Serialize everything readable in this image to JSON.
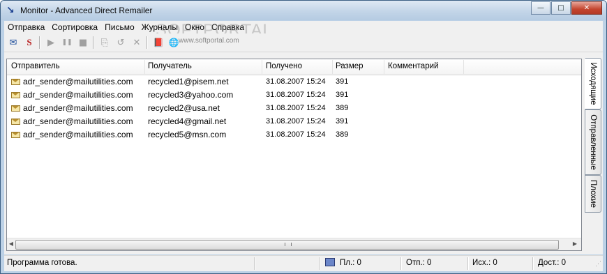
{
  "window": {
    "title": "Monitor - Advanced Direct Remailer",
    "controls": {
      "minimize": "—",
      "maximize": "□",
      "close": "✕"
    }
  },
  "menu": [
    "Отправка",
    "Сортировка",
    "Письмо",
    "Журналы",
    "Окно",
    "Справка"
  ],
  "watermark": {
    "logo": "SOFTPORTAL",
    "url": "www.softportal.com"
  },
  "toolbar": [
    {
      "icon": "new-message-icon",
      "glyph": "✉",
      "enabled": true
    },
    {
      "icon": "smtp-icon",
      "glyph": "S",
      "enabled": true
    },
    {
      "icon": "play-icon",
      "glyph": "▶",
      "enabled": false
    },
    {
      "icon": "pause-icon",
      "glyph": "❚❚",
      "enabled": false
    },
    {
      "icon": "stop-icon",
      "glyph": "■",
      "enabled": false
    },
    {
      "icon": "copy-icon",
      "glyph": "⎘",
      "enabled": false
    },
    {
      "icon": "resend-icon",
      "glyph": "↺",
      "enabled": false
    },
    {
      "icon": "delete-icon",
      "glyph": "✕",
      "enabled": false
    },
    {
      "icon": "address-book-icon",
      "glyph": "📕",
      "enabled": true
    },
    {
      "icon": "internet-globe-icon",
      "glyph": "🌐",
      "enabled": true
    }
  ],
  "table": {
    "columns": [
      "Отправитель",
      "Получатель",
      "Получено",
      "Размер",
      "Комментарий"
    ],
    "rows": [
      {
        "sender": "adr_sender@mailutilities.com",
        "recipient": "recycled1@pisem.net",
        "received": "31.08.2007 15:24",
        "size": "391",
        "comment": ""
      },
      {
        "sender": "adr_sender@mailutilities.com",
        "recipient": "recycled3@yahoo.com",
        "received": "31.08.2007 15:24",
        "size": "391",
        "comment": ""
      },
      {
        "sender": "adr_sender@mailutilities.com",
        "recipient": "recycled2@usa.net",
        "received": "31.08.2007 15:24",
        "size": "389",
        "comment": ""
      },
      {
        "sender": "adr_sender@mailutilities.com",
        "recipient": "recycled4@gmail.net",
        "received": "31.08.2007 15:24",
        "size": "391",
        "comment": ""
      },
      {
        "sender": "adr_sender@mailutilities.com",
        "recipient": "recycled5@msn.com",
        "received": "31.08.2007 15:24",
        "size": "389",
        "comment": ""
      }
    ]
  },
  "tabs": [
    {
      "label": "Исходящие",
      "active": true
    },
    {
      "label": "Отправленные",
      "active": false
    },
    {
      "label": "Плохие",
      "active": false
    }
  ],
  "status": {
    "message": "Программа готова.",
    "planned": "Пл.: 0",
    "sent": "Отп.: 0",
    "outgoing": "Исх.: 0",
    "delivered": "Дост.: 0"
  }
}
